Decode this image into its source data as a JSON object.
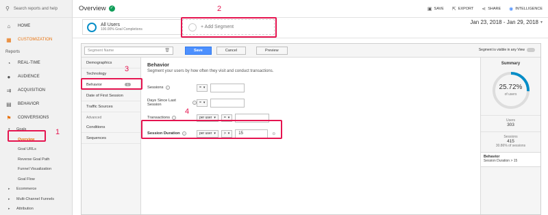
{
  "sidebar": {
    "search_placeholder": "Search reports and help",
    "nav": [
      {
        "label": "HOME",
        "icon": "home-icon",
        "glyph": "⌂"
      },
      {
        "label": "CUSTOMIZATION",
        "icon": "grid-icon",
        "glyph": "▦"
      }
    ],
    "reports_label": "Reports",
    "reports": [
      {
        "label": "REAL-TIME",
        "icon": "clock-icon",
        "glyph": "◔"
      },
      {
        "label": "AUDIENCE",
        "icon": "person-icon",
        "glyph": "●"
      },
      {
        "label": "ACQUISITION",
        "icon": "acquisition-icon",
        "glyph": "⇉"
      },
      {
        "label": "BEHAVIOR",
        "icon": "behavior-icon",
        "glyph": "▤"
      },
      {
        "label": "CONVERSIONS",
        "icon": "flag-icon",
        "glyph": "⚑"
      }
    ],
    "goals_label": "Goals",
    "goal_items": [
      "Overview",
      "Goal URLs",
      "Reverse Goal Path",
      "Funnel Visualization",
      "Goal Flow"
    ],
    "other_items": [
      "Ecommerce",
      "Multi-Channel Funnels",
      "Attribution"
    ]
  },
  "header": {
    "title": "Overview",
    "actions": [
      {
        "label": "SAVE",
        "icon": "save-icon",
        "glyph": "▣"
      },
      {
        "label": "EXPORT",
        "icon": "export-icon",
        "glyph": "⇱"
      },
      {
        "label": "SHARE",
        "icon": "share-icon",
        "glyph": "⋖"
      },
      {
        "label": "INTELLIGENCE",
        "icon": "intelligence-icon",
        "glyph": "◉"
      }
    ]
  },
  "segments": {
    "all_users_title": "All Users",
    "all_users_sub": "100.00% Goal Completions",
    "add_segment": "+ Add Segment",
    "date_range": "Jan 23, 2018 - Jan 29, 2018"
  },
  "builder": {
    "segment_name_placeholder": "Segment Name",
    "save": "Save",
    "cancel": "Cancel",
    "preview": "Preview",
    "visibility": "Segment is visible in any View",
    "left_nav": [
      "Demographics",
      "Technology",
      "Behavior",
      "Date of First Session",
      "Traffic Sources"
    ],
    "behavior_badge": "1",
    "advanced_label": "Advanced",
    "advanced_items": [
      "Conditions",
      "Sequences"
    ],
    "section_title": "Behavior",
    "section_sub": "Segment your users by how often they visit and conduct transactions.",
    "fields": {
      "sessions": {
        "label": "Sessions",
        "op": "=",
        "value": ""
      },
      "days_since": {
        "label": "Days Since Last Session",
        "op": "=",
        "value": ""
      },
      "transactions": {
        "label": "Transactions",
        "scope": "per user",
        "op": "=",
        "value": ""
      },
      "session_duration": {
        "label": "Session Duration",
        "scope": "per user",
        "op": ">",
        "value": "15"
      }
    }
  },
  "summary": {
    "title": "Summary",
    "percent": "25.72%",
    "percent_value": 25.72,
    "of_label": "of users",
    "users_label": "Users",
    "users_value": "303",
    "sessions_label": "Sessions",
    "sessions_value": "415",
    "sessions_pct": "30.86% of sessions",
    "condition_title": "Behavior",
    "condition_text": "Session Duration > 15"
  },
  "annotations": [
    "1",
    "2",
    "3",
    "4"
  ],
  "colors": {
    "highlight": "#e5134f",
    "accent": "#e8710a",
    "primary": "#4d90fe",
    "donut": "#058dc7"
  }
}
